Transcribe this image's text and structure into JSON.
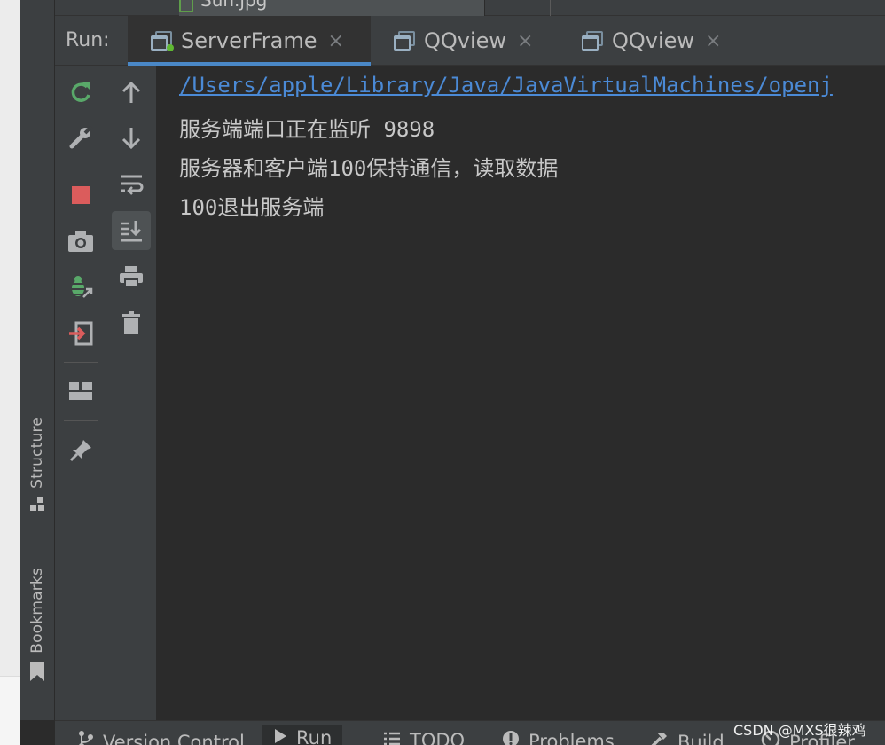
{
  "editor_tab": {
    "file_name": "Sun.jpg"
  },
  "run_window": {
    "label": "Run:",
    "tabs": [
      {
        "label": "ServerFrame",
        "active": true
      },
      {
        "label": "QQview",
        "active": false
      },
      {
        "label": "QQview",
        "active": false
      }
    ],
    "close_glyph": "×"
  },
  "side_stripe": {
    "structure_label": "Structure",
    "bookmarks_label": "Bookmarks"
  },
  "toolbar_left": {
    "icons": [
      "rerun-icon",
      "settings-wrench-icon",
      "stop-icon",
      "camera-dump-threads-icon",
      "debug-attach-icon",
      "exit-icon",
      "layout-icon",
      "pin-icon"
    ]
  },
  "toolbar_right": {
    "icons": [
      "up-arrow-icon",
      "down-arrow-icon",
      "soft-wrap-icon",
      "scroll-to-end-icon",
      "print-icon",
      "trash-icon"
    ]
  },
  "console": {
    "lines": [
      "/Users/apple/Library/Java/JavaVirtualMachines/openj",
      "服务端端口正在监听 9898",
      "服务器和客户端100保持通信，读取数据",
      "100退出服务端"
    ]
  },
  "bottom_bar": {
    "items": [
      {
        "label": "Version Control",
        "icon": "branch-icon"
      },
      {
        "label": "Run",
        "icon": "play-icon",
        "active": true
      },
      {
        "label": "TODO",
        "icon": "list-icon"
      },
      {
        "label": "Problems",
        "icon": "alert-icon"
      },
      {
        "label": "Build",
        "icon": "hammer-icon"
      },
      {
        "label": "Profiler",
        "icon": "profiler-icon"
      }
    ]
  },
  "watermark": "CSDN @MXS很辣鸡",
  "colors": {
    "background": "#2b2b2b",
    "panel": "#3c3f41",
    "accent": "#4a88c7",
    "link": "#4b8ad6",
    "text": "#c8c8c8",
    "green": "#5fb832",
    "red": "#d14a4a"
  }
}
